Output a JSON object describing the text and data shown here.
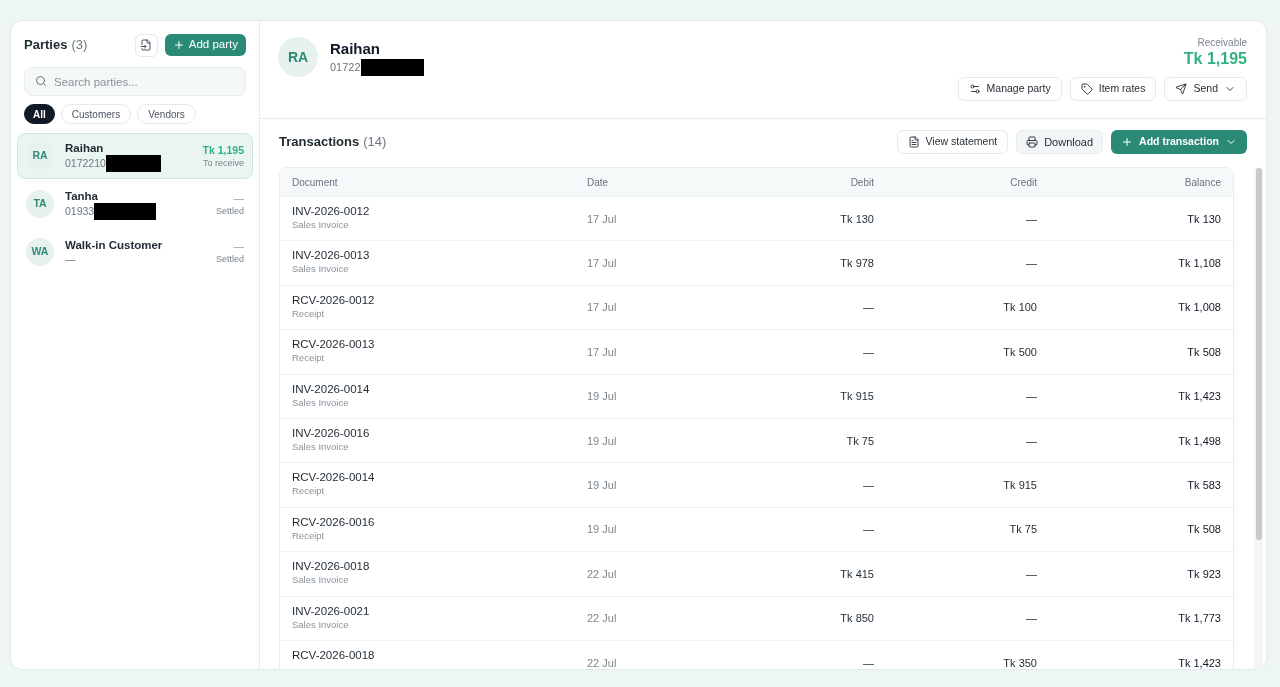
{
  "sidebar": {
    "title": "Parties",
    "count": "(3)",
    "add_button": "Add party",
    "search": {
      "placeholder": "Search parties..."
    },
    "filters": [
      {
        "label": "All",
        "selected": true
      },
      {
        "label": "Customers",
        "selected": false
      },
      {
        "label": "Vendors",
        "selected": false
      }
    ],
    "parties": [
      {
        "initials": "RA",
        "name": "Raihan",
        "phone": "0172210",
        "redacted": true,
        "amount": "Tk 1,195",
        "status": "To receive",
        "kind": "receivable",
        "selected": true
      },
      {
        "initials": "TA",
        "name": "Tanha",
        "phone": "01933",
        "redacted": true,
        "amount": "—",
        "status": "Settled",
        "kind": "settled",
        "selected": false
      },
      {
        "initials": "WA",
        "name": "Walk-in Customer",
        "phone": "—",
        "redacted": false,
        "amount": "—",
        "status": "Settled",
        "kind": "settled",
        "selected": false
      }
    ]
  },
  "party_header": {
    "initials": "RA",
    "name": "Raihan",
    "phone": "01722",
    "redacted": true,
    "receivable_label": "Receivable",
    "receivable_amount": "Tk 1,195",
    "manage_button": "Manage party",
    "rates_button": "Item rates",
    "send_button": "Send"
  },
  "transactions": {
    "title": "Transactions",
    "count": "(14)",
    "statement_button": "View statement",
    "download_button": "Download",
    "add_button": "Add transaction",
    "table": {
      "columns": [
        "Document",
        "Date",
        "Debit",
        "Credit",
        "Balance"
      ],
      "rows": [
        {
          "document": "INV-2026-0012",
          "type": "Sales Invoice",
          "date": "17 Jul",
          "debit": "Tk 130",
          "credit": "—",
          "balance": "Tk 130"
        },
        {
          "document": "INV-2026-0013",
          "type": "Sales Invoice",
          "date": "17 Jul",
          "debit": "Tk 978",
          "credit": "—",
          "balance": "Tk 1,108"
        },
        {
          "document": "RCV-2026-0012",
          "type": "Receipt",
          "date": "17 Jul",
          "debit": "—",
          "credit": "Tk 100",
          "balance": "Tk 1,008"
        },
        {
          "document": "RCV-2026-0013",
          "type": "Receipt",
          "date": "17 Jul",
          "debit": "—",
          "credit": "Tk 500",
          "balance": "Tk 508"
        },
        {
          "document": "INV-2026-0014",
          "type": "Sales Invoice",
          "date": "19 Jul",
          "debit": "Tk 915",
          "credit": "—",
          "balance": "Tk 1,423"
        },
        {
          "document": "INV-2026-0016",
          "type": "Sales Invoice",
          "date": "19 Jul",
          "debit": "Tk 75",
          "credit": "—",
          "balance": "Tk 1,498"
        },
        {
          "document": "RCV-2026-0014",
          "type": "Receipt",
          "date": "19 Jul",
          "debit": "—",
          "credit": "Tk 915",
          "balance": "Tk 583"
        },
        {
          "document": "RCV-2026-0016",
          "type": "Receipt",
          "date": "19 Jul",
          "debit": "—",
          "credit": "Tk 75",
          "balance": "Tk 508"
        },
        {
          "document": "INV-2026-0018",
          "type": "Sales Invoice",
          "date": "22 Jul",
          "debit": "Tk 415",
          "credit": "—",
          "balance": "Tk 923"
        },
        {
          "document": "INV-2026-0021",
          "type": "Sales Invoice",
          "date": "22 Jul",
          "debit": "Tk 850",
          "credit": "—",
          "balance": "Tk 1,773"
        },
        {
          "document": "RCV-2026-0018",
          "date": "22 Jul",
          "debit": "—",
          "credit": "Tk 350",
          "balance": "Tk 1,423"
        }
      ]
    }
  }
}
